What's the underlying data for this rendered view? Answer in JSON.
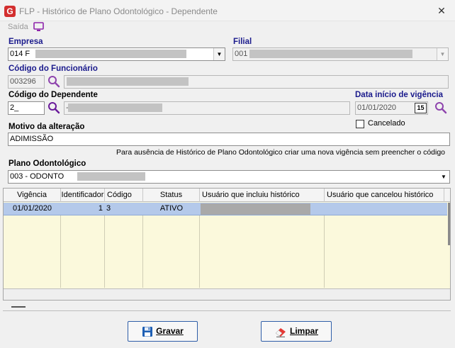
{
  "window": {
    "logo": "G",
    "title": "FLP - Histórico de Plano Odontológico - Dependente",
    "close": "✕"
  },
  "toolbar": {
    "saida_label": "Saída"
  },
  "form": {
    "empresa_label": "Empresa",
    "empresa_value": "014 F",
    "filial_label": "Filial",
    "filial_value": "001",
    "codigo_funcionario_label": "Código do Funcionário",
    "codigo_funcionario_value": "003296",
    "codigo_dependente_label": "Código do Dependente",
    "codigo_dependente_value": "2_",
    "dependente_name_value": "-",
    "data_inicio_label": "Data início de vigência",
    "data_inicio_value": "01/01/2020",
    "calendar_value": "15",
    "cancelado_label": "Cancelado",
    "cancelado_checked": false,
    "motivo_label": "Motivo da alteração",
    "motivo_value": "ADIMISSÃO",
    "hint_text": "Para ausência de Histórico de Plano Odontológico criar uma nova vigência sem preencher o código",
    "plano_label": "Plano Odontológico",
    "plano_value": "003 - ODONTO"
  },
  "grid": {
    "columns": [
      "Vigência",
      "Identificador",
      "Código",
      "Status",
      "Usuário que incluiu histórico",
      "Usuário que cancelou histórico"
    ],
    "rows": [
      {
        "vigencia": "01/01/2020",
        "identificador": "1",
        "codigo": "3",
        "status": "ATIVO",
        "usuario_incluiu": "",
        "usuario_cancelou": ""
      }
    ]
  },
  "buttons": {
    "gravar_label": "Gravar",
    "limpar_label": "Limpar"
  },
  "colors": {
    "label_blue": "#1a1a8c",
    "selected_row": "#b4c9ea",
    "grid_background": "#fbf9dc",
    "button_border": "#2f5ea8",
    "search_icon": "#8e44ad"
  }
}
